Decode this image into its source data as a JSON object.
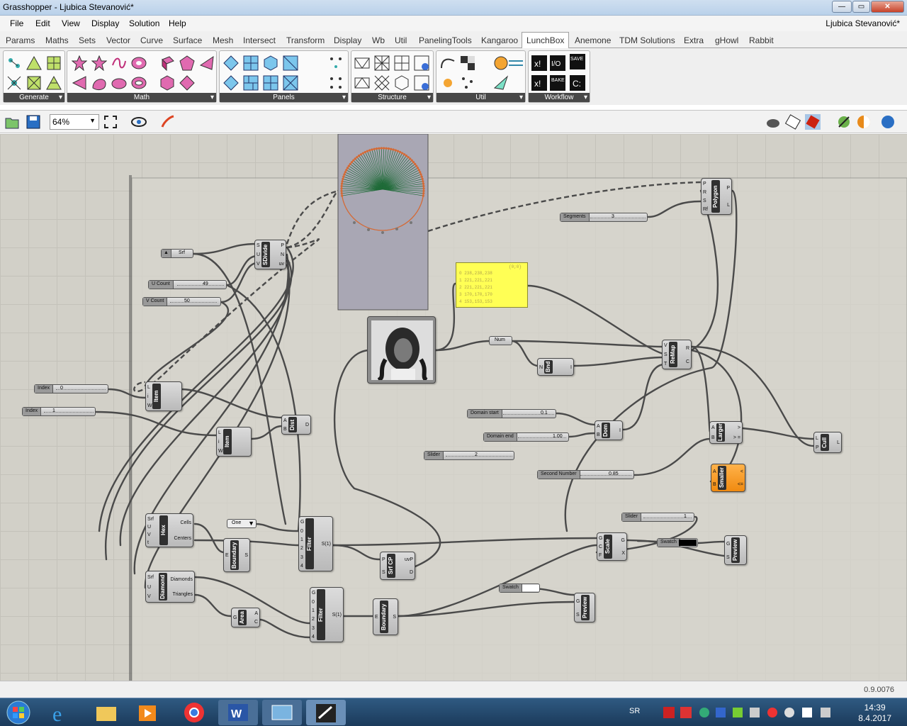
{
  "window": {
    "title": "Grasshopper - Ljubica Stevanović*",
    "min": "—",
    "max": "▭",
    "close": "✕"
  },
  "menu": [
    "File",
    "Edit",
    "View",
    "Display",
    "Solution",
    "Help"
  ],
  "user": "Ljubica Stevanović*",
  "tabs": [
    "Params",
    "Maths",
    "Sets",
    "Vector",
    "Curve",
    "Surface",
    "Mesh",
    "Intersect",
    "Transform",
    "Display",
    "Wb",
    "Util",
    "PanelingTools",
    "Kangaroo",
    "LunchBox",
    "Anemone",
    "TDM Solutions",
    "Extra",
    "gHowl",
    "Rabbit"
  ],
  "active_tab": "LunchBox",
  "ribbon_groups": [
    "Generate",
    "Math",
    "Panels",
    "Structure",
    "Util",
    "Workflow"
  ],
  "toolbar": {
    "zoom": "64%"
  },
  "canvas": {
    "sliders": {
      "u_count": {
        "label": "U Count",
        "value": "49"
      },
      "v_count": {
        "label": "V Count",
        "value": "50"
      },
      "index0": {
        "label": "Index",
        "value": "0"
      },
      "index1": {
        "label": "Index",
        "value": "1"
      },
      "segments": {
        "label": "Segments",
        "value": "3"
      },
      "domain_start": {
        "label": "Domain start",
        "value": "0.1"
      },
      "domain_end": {
        "label": "Domain end",
        "value": "1.00"
      },
      "slider_a": {
        "label": "Slider",
        "value": "2"
      },
      "second_number": {
        "label": "Second Number",
        "value": "0.85"
      },
      "slider_b": {
        "label": "Slider",
        "value": "1"
      }
    },
    "srf": "Srf",
    "one": "One",
    "num": "Num",
    "panel": {
      "path": "{0;0}",
      "rows": [
        "0 238,238,238",
        "1 221,221,221",
        "2 221,221,221",
        "3 170,170,170",
        "4 153,153,153"
      ]
    },
    "swatch1": "Swatch",
    "swatch2": "Swatch",
    "components": {
      "sdivide": {
        "name": "SDivide",
        "in": [
          "S",
          "U",
          "V"
        ],
        "out": [
          "P",
          "N",
          "uv"
        ]
      },
      "item1": {
        "name": "Item",
        "in": [
          "L",
          "i",
          "W"
        ],
        "out": []
      },
      "item2": {
        "name": "Item",
        "in": [
          "L",
          "i",
          "W"
        ],
        "out": []
      },
      "dist": {
        "name": "Dist",
        "in": [
          "A",
          "B"
        ],
        "out": [
          "D"
        ]
      },
      "polygon": {
        "name": "Polygon",
        "in": [
          "P",
          "R",
          "S",
          "Rf"
        ],
        "out": [
          "P",
          "L"
        ]
      },
      "bnd": {
        "name": "Bnd",
        "in": [
          "N"
        ],
        "out": [
          "I"
        ]
      },
      "remap": {
        "name": "ReMap",
        "in": [
          "V",
          "S",
          "T"
        ],
        "out": [
          "R",
          "C"
        ]
      },
      "dom": {
        "name": "Dom",
        "in": [
          "A",
          "B"
        ],
        "out": [
          "I"
        ]
      },
      "larger": {
        "name": "Larger",
        "in": [
          "A",
          "B"
        ],
        "out": [
          ">",
          "> ="
        ]
      },
      "smaller": {
        "name": "Smaller",
        "in": [
          "A",
          "B"
        ],
        "out": [
          "<",
          "<="
        ]
      },
      "cull": {
        "name": "Cull",
        "in": [
          "L",
          "P"
        ],
        "out": [
          "L"
        ]
      },
      "hex": {
        "name": "Hex",
        "in": [
          "Srf",
          "U",
          "V",
          "t"
        ],
        "out": [
          "Cells",
          "Centers"
        ]
      },
      "boundary1": {
        "name": "Boundary",
        "in": [
          "E"
        ],
        "out": [
          "S"
        ]
      },
      "filter1": {
        "name": "Filter",
        "in": [
          "G",
          "0",
          "1",
          "2",
          "3",
          "4"
        ],
        "out": [
          "S(1)"
        ]
      },
      "srfcp": {
        "name": "Srf CP",
        "in": [
          "P",
          "S"
        ],
        "out": [
          "uvP",
          "D"
        ]
      },
      "scale": {
        "name": "Scale",
        "in": [
          "G",
          "C",
          "F"
        ],
        "out": [
          "G",
          "X"
        ]
      },
      "preview1": {
        "name": "Preview",
        "in": [
          "G",
          "S"
        ],
        "out": []
      },
      "diamond": {
        "name": "Diamond",
        "in": [
          "Srf",
          "U",
          "V"
        ],
        "out": [
          "Diamonds",
          "Triangles"
        ]
      },
      "area": {
        "name": "Area",
        "in": [
          "G"
        ],
        "out": [
          "A",
          "C"
        ]
      },
      "filter2": {
        "name": "Filter",
        "in": [
          "G",
          "0",
          "1",
          "2",
          "3",
          "4"
        ],
        "out": [
          "S(1)"
        ]
      },
      "boundary2": {
        "name": "Boundary",
        "in": [
          "E"
        ],
        "out": [
          "S"
        ]
      },
      "preview2": {
        "name": "Preview",
        "in": [
          "G",
          "S"
        ],
        "out": []
      }
    }
  },
  "status": {
    "version": "0.9.0076"
  },
  "taskbar": {
    "lang": "SR",
    "time": "14:39",
    "date": "8.4.2017"
  }
}
